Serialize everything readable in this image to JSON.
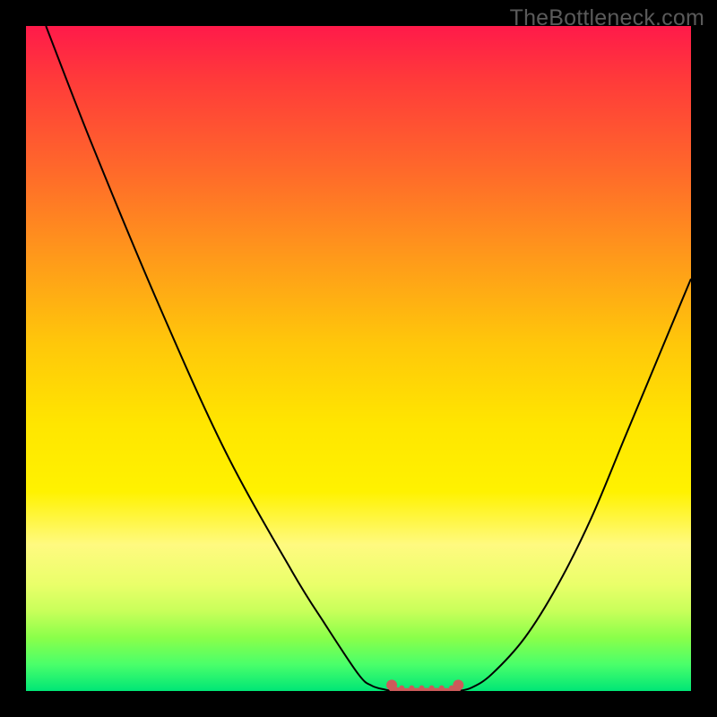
{
  "watermark": "TheBottleneck.com",
  "colors": {
    "frame": "#000000",
    "curve_stroke": "#000000",
    "marker_stroke": "#cc5a5a",
    "marker_fill": "#cc5a5a",
    "gradient_top": "#ff1a4a",
    "gradient_bottom": "#00e676"
  },
  "chart_data": {
    "type": "line",
    "title": "",
    "xlabel": "",
    "ylabel": "",
    "xlim": [
      0,
      100
    ],
    "ylim": [
      0,
      100
    ],
    "grid": false,
    "legend": false,
    "series": [
      {
        "name": "left-curve",
        "x": [
          3,
          10,
          20,
          30,
          40,
          45,
          50,
          52,
          54,
          55
        ],
        "y": [
          100,
          82,
          58,
          36,
          18,
          10,
          2.5,
          0.8,
          0.2,
          0
        ]
      },
      {
        "name": "right-curve",
        "x": [
          65,
          67,
          70,
          75,
          80,
          85,
          90,
          95,
          100
        ],
        "y": [
          0,
          0.5,
          2.5,
          8,
          16,
          26,
          38,
          50,
          62
        ]
      },
      {
        "name": "flat-bottom-markers",
        "x": [
          55,
          56.5,
          58,
          59.5,
          61,
          62.5,
          64,
          65
        ],
        "y": [
          0.3,
          0.05,
          0.05,
          0.05,
          0.05,
          0.05,
          0.05,
          0.3
        ]
      }
    ],
    "marker_endpoints": {
      "left_dot": {
        "x": 55,
        "y": 0.9
      },
      "right_dot": {
        "x": 65,
        "y": 0.9
      }
    }
  }
}
